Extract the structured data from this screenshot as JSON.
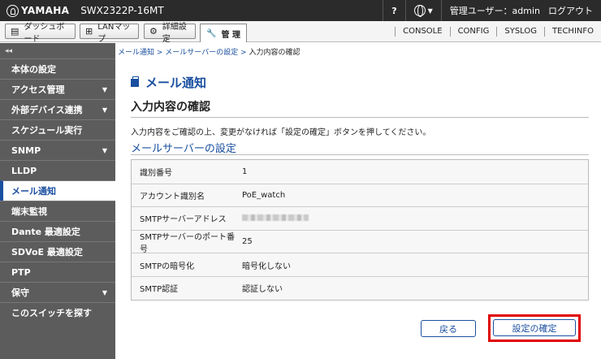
{
  "header": {
    "brand": "YAMAHA",
    "model": "SWX2322P-16MT",
    "help": "?",
    "user": "管理ユーザー：admin",
    "logout": "ログアウト"
  },
  "nav": {
    "dashboard": "ダッシュボード",
    "lanmap": "LANマップ",
    "detail": "詳細設定",
    "manage": "管 理",
    "links": [
      "CONSOLE",
      "CONFIG",
      "SYSLOG",
      "TECHINFO"
    ]
  },
  "sidebar": {
    "collapse": "◂◂",
    "items": [
      {
        "label": "本体の設定",
        "arrow": false,
        "active": false
      },
      {
        "label": "アクセス管理",
        "arrow": true,
        "active": false
      },
      {
        "label": "外部デバイス連携",
        "arrow": true,
        "active": false
      },
      {
        "label": "スケジュール実行",
        "arrow": false,
        "active": false
      },
      {
        "label": "SNMP",
        "arrow": true,
        "active": false
      },
      {
        "label": "LLDP",
        "arrow": false,
        "active": false
      },
      {
        "label": "メール通知",
        "arrow": false,
        "active": true
      },
      {
        "label": "端末監視",
        "arrow": false,
        "active": false
      },
      {
        "label": "Dante 最適設定",
        "arrow": false,
        "active": false
      },
      {
        "label": "SDVoE 最適設定",
        "arrow": false,
        "active": false
      },
      {
        "label": "PTP",
        "arrow": false,
        "active": false
      },
      {
        "label": "保守",
        "arrow": true,
        "active": false
      },
      {
        "label": "このスイッチを探す",
        "arrow": false,
        "active": false
      }
    ]
  },
  "breadcrumb": {
    "item1": "メール通知",
    "sep": " > ",
    "item2": "メールサーバーの設定",
    "current": "入力内容の確認"
  },
  "page": {
    "title": "メール通知",
    "subtitle": "入力内容の確認",
    "description": "入力内容をご確認の上、変更がなければ「設定の確定」ボタンを押してください。",
    "section": "メールサーバーの設定"
  },
  "table": {
    "rows": [
      {
        "label": "識別番号",
        "value": "1"
      },
      {
        "label": "アカウント識別名",
        "value": "PoE_watch"
      },
      {
        "label": "SMTPサーバーアドレス",
        "value": ""
      },
      {
        "label": "SMTPサーバーのポート番号",
        "value": "25"
      },
      {
        "label": "SMTPの暗号化",
        "value": "暗号化しない"
      },
      {
        "label": "SMTP認証",
        "value": "認証しない"
      }
    ]
  },
  "buttons": {
    "back": "戻る",
    "confirm": "設定の確定"
  },
  "colors": {
    "accent": "#1a4fa0",
    "highlight": "#e00000",
    "sidebar": "#5c5c5c",
    "header": "#2b2b2b"
  }
}
